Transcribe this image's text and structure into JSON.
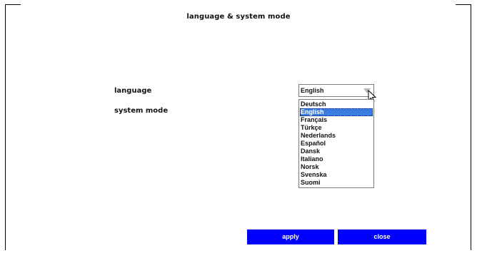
{
  "dialog": {
    "title": "language & system mode"
  },
  "form": {
    "language_label": "language",
    "system_mode_label": "system mode",
    "language_select": {
      "selected": "English",
      "options": [
        "Deutsch",
        "English",
        "Français",
        "Türkçe",
        "Nederlands",
        "Español",
        "Dansk",
        "Italiano",
        "Norsk",
        "Svenska",
        "Suomi"
      ],
      "highlighted_index": 1
    }
  },
  "buttons": {
    "apply_label": "apply",
    "close_label": "close"
  },
  "colors": {
    "button_bg": "#0000ff",
    "highlight_bg": "#3b7de0"
  }
}
